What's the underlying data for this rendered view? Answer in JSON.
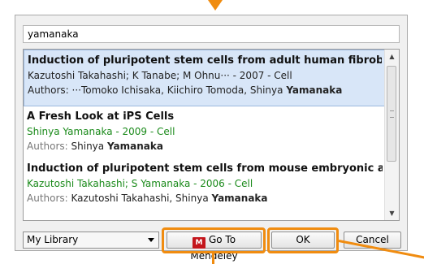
{
  "search": {
    "value": "yamanaka"
  },
  "results": [
    {
      "title": "Induction of pluripotent stem cells from adult human fibroblast",
      "meta": "Kazutoshi Takahashi; K Tanabe; M Ohnu··· - 2007 - Cell",
      "authors_label": "Authors: ",
      "authors_plain": "···Tomoko Ichisaka, Kiichiro Tomoda, Shinya ",
      "authors_bold": "Yamanaka",
      "selected": true
    },
    {
      "title": "A Fresh Look at iPS Cells",
      "meta": "Shinya Yamanaka - 2009 - Cell",
      "authors_label": "Authors: ",
      "authors_plain": "Shinya ",
      "authors_bold": "Yamanaka",
      "selected": false
    },
    {
      "title": "Induction of pluripotent stem cells from mouse embryonic and",
      "meta": "Kazutoshi Takahashi; S Yamanaka - 2006 - Cell",
      "authors_label": "Authors: ",
      "authors_plain": "Kazutoshi Takahashi, Shinya ",
      "authors_bold": "Yamanaka",
      "selected": false
    }
  ],
  "library_select": {
    "value": "My Library"
  },
  "buttons": {
    "mendeley": "Go To Mendeley",
    "mendeley_logo": "M",
    "ok": "OK",
    "cancel": "Cancel"
  },
  "colors": {
    "highlight": "#f08c10",
    "selection": "#d8e6f8",
    "meta_green": "#1a8a1a",
    "logo_red": "#c4161c"
  },
  "icons": {
    "scroll_up": "up-arrow-icon",
    "scroll_down": "down-arrow-icon",
    "dropdown": "chevron-down-icon",
    "mendeley": "mendeley-logo-icon"
  }
}
